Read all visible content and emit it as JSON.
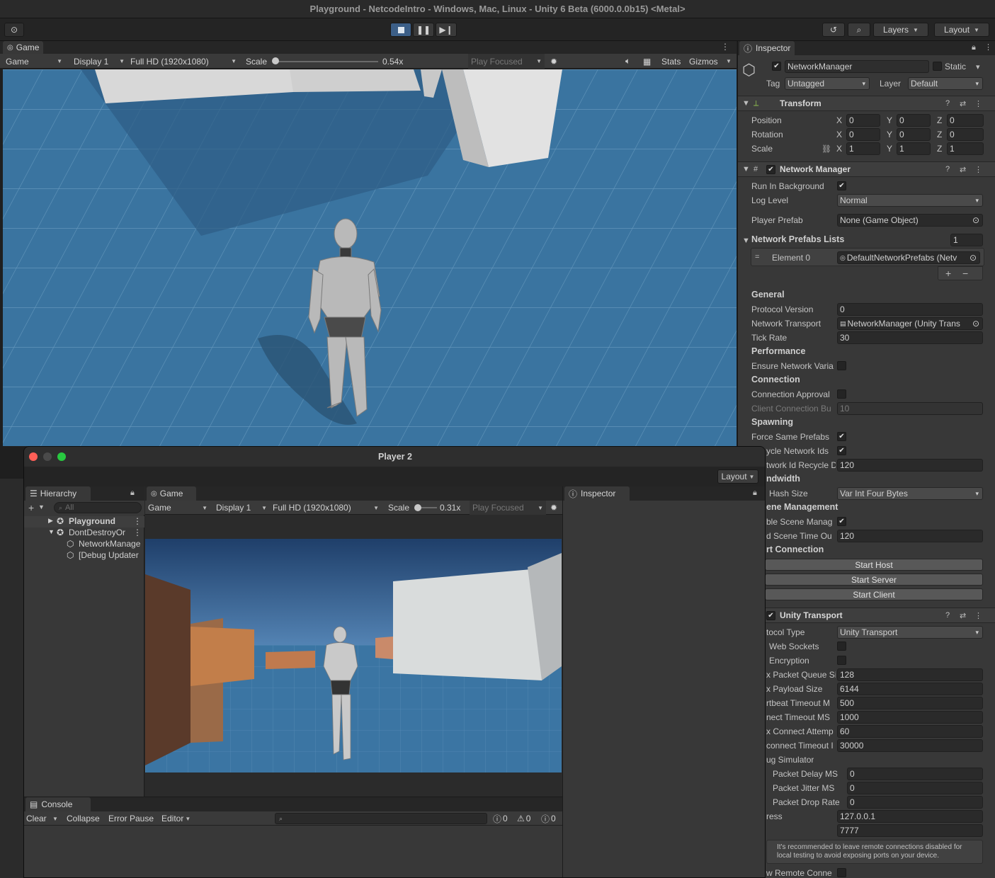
{
  "window_title": "Playground - NetcodeIntro - Windows, Mac, Linux - Unity 6 Beta (6000.0.0b15) <Metal>",
  "toolbar": {
    "layers": "Layers",
    "layout": "Layout"
  },
  "game_panel": {
    "tab": "Game",
    "view_mode": "Game",
    "display": "Display 1",
    "resolution": "Full HD (1920x1080)",
    "scale_label": "Scale",
    "scale_value": "0.54x",
    "scale_fraction": 0.0,
    "play_focused": "Play Focused",
    "stats": "Stats",
    "gizmos": "Gizmos"
  },
  "inspector": {
    "tab": "Inspector",
    "object_name": "NetworkManager",
    "static_label": "Static",
    "tag_label": "Tag",
    "tag_value": "Untagged",
    "layer_label": "Layer",
    "layer_value": "Default",
    "transform": {
      "title": "Transform",
      "position_label": "Position",
      "rotation_label": "Rotation",
      "scale_label": "Scale",
      "x": "X",
      "y": "Y",
      "z": "Z",
      "position": [
        "0",
        "0",
        "0"
      ],
      "rotation": [
        "0",
        "0",
        "0"
      ],
      "scale": [
        "1",
        "1",
        "1"
      ]
    },
    "network_manager": {
      "title": "Network Manager",
      "run_in_background": "Run In Background",
      "log_level": "Log Level",
      "log_level_value": "Normal",
      "player_prefab": "Player Prefab",
      "player_prefab_value": "None (Game Object)",
      "prefabs_lists": "Network Prefabs Lists",
      "prefabs_lists_count": "1",
      "element0": "Element 0",
      "element0_value": "DefaultNetworkPrefabs (Netv",
      "general": "General",
      "protocol_version": "Protocol Version",
      "protocol_version_value": "0",
      "network_transport": "Network Transport",
      "network_transport_value": "NetworkManager (Unity Trans",
      "tick_rate": "Tick Rate",
      "tick_rate_value": "30",
      "performance": "Performance",
      "ensure_network_vars": "Ensure Network Varia",
      "connection": "Connection",
      "connection_approval": "Connection Approval",
      "client_connection_buffer": "Client Connection Bu",
      "client_connection_buffer_value": "10",
      "spawning": "Spawning",
      "force_same_prefabs": "Force Same Prefabs",
      "recycle_network_ids": "ycle Network Ids",
      "network_id_recycle_delay": "twork Id Recycle D",
      "network_id_recycle_delay_value": "120",
      "bandwidth": "ndwidth",
      "hash_size": "Hash Size",
      "hash_size_value": "Var Int Four Bytes",
      "scene_management": "ene Management",
      "enable_scene_management": "ble Scene Manag",
      "load_scene_timeout": "d Scene Time Ou",
      "load_scene_timeout_value": "120",
      "start_connection": "rt Connection",
      "start_host": "Start Host",
      "start_server": "Start Server",
      "start_client": "Start Client"
    },
    "unity_transport": {
      "title": "Unity Transport",
      "protocol_type": "tocol Type",
      "protocol_type_value": "Unity Transport",
      "web_sockets": "Web Sockets",
      "encryption": "Encryption",
      "max_packet_queue": "x Packet Queue Si",
      "max_packet_queue_value": "128",
      "max_payload": "x Payload Size",
      "max_payload_value": "6144",
      "heartbeat": "rtbeat Timeout M",
      "heartbeat_value": "500",
      "connect_timeout": "nect Timeout MS",
      "connect_timeout_value": "1000",
      "max_connect_attempts": "x Connect Attemp",
      "max_connect_attempts_value": "60",
      "disconnect_timeout": "connect Timeout I",
      "disconnect_timeout_value": "30000",
      "debug_simulator": "ug Simulator",
      "packet_delay": "Packet Delay MS",
      "packet_delay_value": "0",
      "packet_jitter": "Packet Jitter MS",
      "packet_jitter_value": "0",
      "packet_drop": "Packet Drop Rate",
      "packet_drop_value": "0",
      "address": "ress",
      "address_value": "127.0.0.1",
      "port_value": "7777",
      "warning": "It's recommended to leave remote connections disabled for local testing to avoid exposing ports on your device.",
      "allow_remote": "w Remote Conne"
    }
  },
  "player2": {
    "title": "Player 2",
    "layout": "Layout",
    "hierarchy": {
      "tab": "Hierarchy",
      "search_placeholder": "All",
      "items": [
        "Playground",
        "DontDestroyOr",
        "NetworkManage",
        "[Debug Updater"
      ]
    },
    "game": {
      "tab": "Game",
      "view_mode": "Game",
      "display": "Display 1",
      "resolution": "Full HD (1920x1080)",
      "scale_label": "Scale",
      "scale_value": "0.31x",
      "play_focused": "Play Focused"
    },
    "inspector_tab": "Inspector",
    "console": {
      "tab": "Console",
      "clear": "Clear",
      "collapse": "Collapse",
      "error_pause": "Error Pause",
      "editor": "Editor",
      "count_log": "0",
      "count_warn": "0",
      "count_err": "0"
    }
  }
}
